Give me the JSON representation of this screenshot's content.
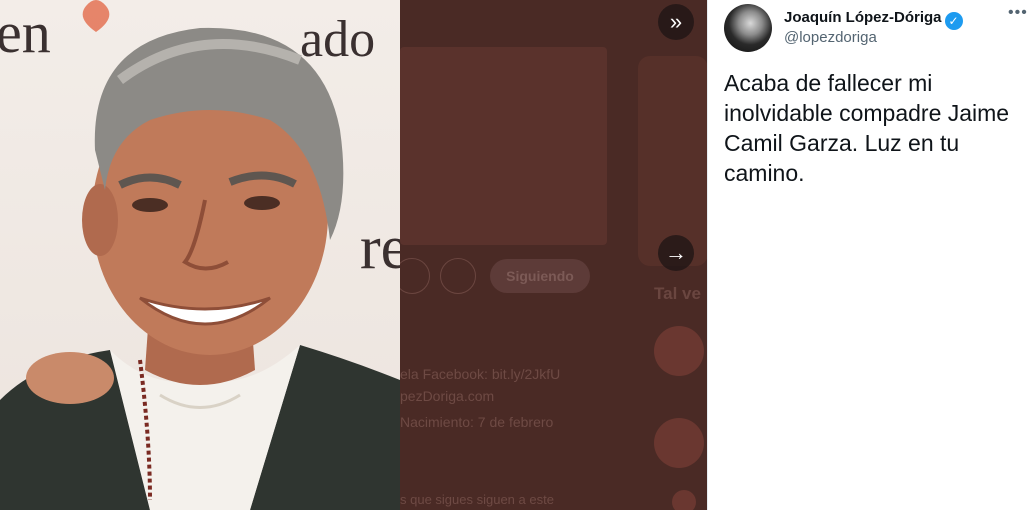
{
  "tweet": {
    "author_name": "Joaquín López-Dóriga",
    "handle": "@lopezdoriga",
    "text": "Acaba de fallecer mi inolvidable compadre Jaime Camil Garza. Luz en tu camino.",
    "more_glyph": "•••",
    "verified_glyph": "✓"
  },
  "photo_backdrop": {
    "text_top": "en",
    "text_right_top": "ado",
    "text_right_mid": "re"
  },
  "background_page": {
    "follow_label": "Siguiendo",
    "section_heading": "Tal ve",
    "facebook_line": "ela Facebook: bit.ly/2JkfU",
    "site_line": "pezDoriga.com",
    "birth_line": "Nacimiento: 7 de febrero",
    "followers_line": "s que sigues siguen a este"
  },
  "nav": {
    "collapse_glyph": "»",
    "next_glyph": "→"
  },
  "colors": {
    "verified": "#1d9bf0",
    "overlay": "#4a2a25",
    "text_primary": "#0f1419",
    "text_secondary": "#536471"
  }
}
